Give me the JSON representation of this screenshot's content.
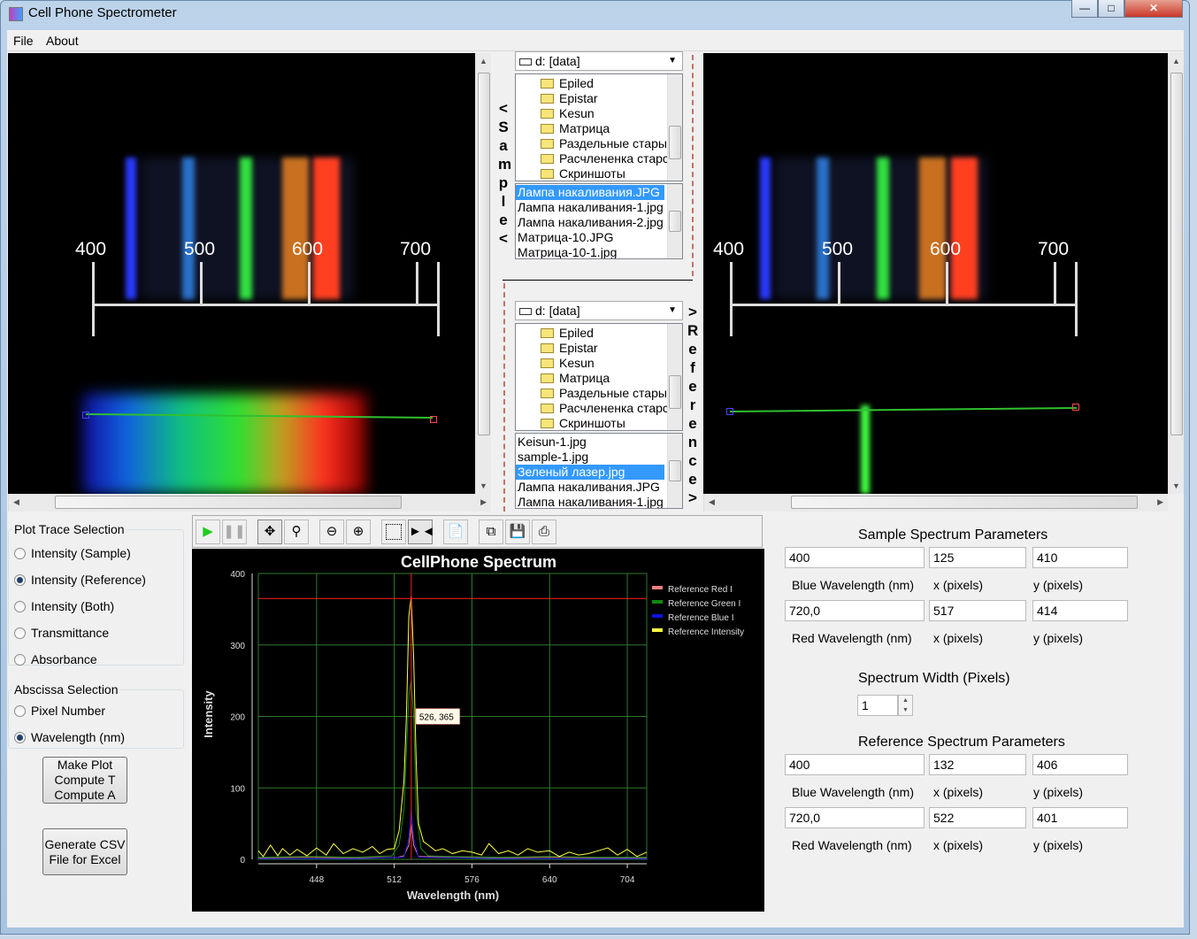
{
  "window": {
    "title": "Cell Phone Spectrometer",
    "controls": [
      "minimize",
      "maximize",
      "close"
    ]
  },
  "menu": [
    "File",
    "About"
  ],
  "sample_image": {
    "scale_labels": [
      "400",
      "500",
      "600",
      "700"
    ]
  },
  "reference_image": {
    "scale_labels": [
      "400",
      "500",
      "600",
      "700"
    ]
  },
  "sample_browser": {
    "side_label": "<Sample<",
    "drive": "d: [data]",
    "folders": [
      "Epiled",
      "Epistar",
      "Kesun",
      "Матрица",
      "Раздельные стары",
      "Расчлененка старс",
      "Скриншоты"
    ],
    "files": [
      "Лампа накаливания.JPG",
      "Лампа накаливания-1.jpg",
      "Лампа накаливания-2.jpg",
      "Матрица-10.JPG",
      "Матрица-10-1.jpg"
    ],
    "selected_file": 0
  },
  "reference_browser": {
    "side_label": ">Reference>",
    "drive": "d: [data]",
    "folders": [
      "Epiled",
      "Epistar",
      "Kesun",
      "Матрица",
      "Раздельные стары",
      "Расчлененка старс",
      "Скриншоты"
    ],
    "files": [
      "Keisun-1.jpg",
      "sample-1.jpg",
      "Зеленый лазер.jpg",
      "Лампа накаливания.JPG",
      "Лампа накаливания-1.jpg"
    ],
    "selected_file": 2
  },
  "plot_trace": {
    "legend": "Plot Trace Selection",
    "options": [
      "Intensity (Sample)",
      "Intensity (Reference)",
      "Intensity (Both)",
      "Transmittance",
      "Absorbance"
    ],
    "selected": 1
  },
  "abscissa": {
    "legend": "Abscissa Selection",
    "options": [
      "Pixel Number",
      "Wavelength (nm)"
    ],
    "selected": 1
  },
  "buttons": {
    "make_plot": [
      "Make Plot",
      "Compute T",
      "Compute A"
    ],
    "csv": [
      "Generate CSV",
      "File for Excel"
    ]
  },
  "toolbar": [
    "play",
    "pause",
    "pan",
    "zoom-fit",
    "zoom-out",
    "zoom-in",
    "select-rect",
    "cursor",
    "properties",
    "copy",
    "save",
    "print"
  ],
  "sample_params": {
    "title": "Sample Spectrum Parameters",
    "blue": {
      "wavelength": "400",
      "x": "125",
      "y": "410"
    },
    "red": {
      "wavelength": "720,0",
      "x": "517",
      "y": "414"
    },
    "labels": {
      "blue": "Blue Wavelength (nm)",
      "red": "Red Wavelength (nm)",
      "x": "x (pixels)",
      "y": "y (pixels)"
    }
  },
  "spectrum_width": {
    "label": "Spectrum Width (Pixels)",
    "value": "1"
  },
  "reference_params": {
    "title": "Reference Spectrum Parameters",
    "blue": {
      "wavelength": "400",
      "x": "132",
      "y": "406"
    },
    "red": {
      "wavelength": "720,0",
      "x": "522",
      "y": "401"
    },
    "labels": {
      "blue": "Blue Wavelength (nm)",
      "red": "Red Wavelength (nm)",
      "x": "x (pixels)",
      "y": "y (pixels)"
    }
  },
  "chart_data": {
    "type": "line",
    "title": "CellPhone Spectrum",
    "xlabel": "Wavelength (nm)",
    "ylabel": "Intensity",
    "xlim": [
      400,
      720
    ],
    "ylim": [
      0,
      400
    ],
    "xticks": [
      448,
      512,
      576,
      640,
      704
    ],
    "yticks": [
      0,
      100,
      200,
      300,
      400
    ],
    "grid": true,
    "legend_placement": "right",
    "crosshair": {
      "x": 526,
      "y": 365,
      "label": "526, 365",
      "color": "#ff2020"
    },
    "series": [
      {
        "name": "Reference Red I",
        "color": "#f08080",
        "x": [
          400,
          440,
          480,
          515,
          520,
          524,
          526,
          528,
          532,
          560,
          600,
          640,
          680,
          720
        ],
        "y": [
          2,
          3,
          2,
          3,
          5,
          20,
          50,
          20,
          4,
          3,
          2,
          3,
          2,
          2
        ]
      },
      {
        "name": "Reference Green I",
        "color": "#118811",
        "x": [
          400,
          440,
          480,
          510,
          516,
          520,
          522,
          524,
          526,
          528,
          530,
          534,
          540,
          560,
          600,
          640,
          680,
          720
        ],
        "y": [
          3,
          4,
          3,
          5,
          20,
          70,
          150,
          230,
          250,
          200,
          70,
          15,
          5,
          4,
          3,
          4,
          3,
          3
        ]
      },
      {
        "name": "Reference Blue I",
        "color": "#1010dd",
        "x": [
          400,
          480,
          520,
          524,
          526,
          528,
          532,
          600,
          720
        ],
        "y": [
          1,
          1,
          3,
          30,
          68,
          30,
          3,
          1,
          1
        ]
      },
      {
        "name": "Reference Intensity",
        "color": "#ffff44",
        "x": [
          400,
          404,
          410,
          416,
          420,
          426,
          432,
          440,
          448,
          456,
          462,
          470,
          478,
          486,
          494,
          500,
          506,
          512,
          516,
          520,
          522,
          524,
          526,
          528,
          530,
          532,
          536,
          540,
          546,
          552,
          560,
          568,
          576,
          584,
          590,
          598,
          606,
          614,
          622,
          630,
          640,
          648,
          656,
          664,
          672,
          680,
          688,
          696,
          704,
          712,
          720
        ],
        "y": [
          12,
          4,
          20,
          5,
          15,
          6,
          14,
          5,
          16,
          6,
          22,
          8,
          15,
          10,
          18,
          8,
          14,
          15,
          40,
          110,
          200,
          340,
          368,
          280,
          140,
          50,
          25,
          20,
          12,
          15,
          8,
          12,
          10,
          6,
          22,
          8,
          12,
          6,
          15,
          10,
          12,
          4,
          10,
          6,
          8,
          12,
          16,
          6,
          14,
          4,
          10
        ]
      }
    ]
  }
}
